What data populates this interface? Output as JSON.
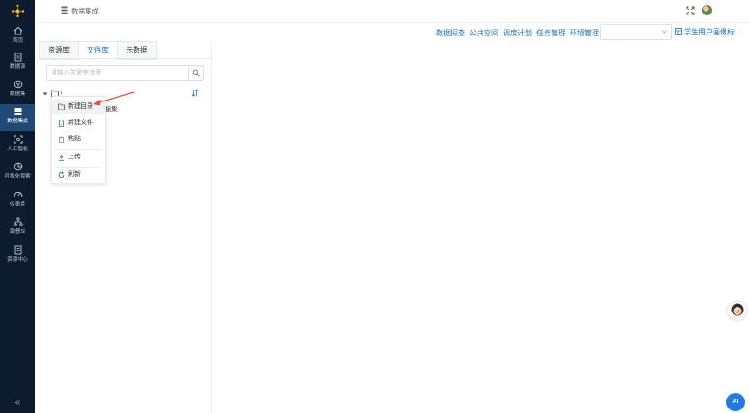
{
  "nav": {
    "items": [
      {
        "label": "首页",
        "icon": "home-icon"
      },
      {
        "label": "数据源",
        "icon": "database-icon"
      },
      {
        "label": "数据集",
        "icon": "dataset-icon"
      },
      {
        "label": "数据集成",
        "icon": "integration-icon",
        "active": true
      },
      {
        "label": "人工智能",
        "icon": "ai-icon"
      },
      {
        "label": "可视化探索",
        "icon": "chart-icon"
      },
      {
        "label": "仪表盘",
        "icon": "dashboard-icon"
      },
      {
        "label": "助督SI",
        "icon": "tree-icon"
      },
      {
        "label": "资源中心",
        "icon": "book-icon"
      }
    ],
    "collapse_glyph": "«",
    "active_color": "#1f4a78"
  },
  "header": {
    "breadcrumb": "数据集成",
    "links": [
      "数据探查",
      "公共空间",
      "调度计划",
      "任务管理",
      "环境管理"
    ],
    "select_value": "",
    "profile_link": "学生用户画像标..."
  },
  "panel": {
    "tabs": [
      "资源库",
      "文件库",
      "元数据"
    ],
    "active_tab": 1,
    "search_placeholder": "请输入关键字检索",
    "tree_root": "/",
    "tree_child_visible": "据集"
  },
  "context_menu": {
    "items": [
      {
        "label": "新建目录",
        "icon": "folder-icon"
      },
      {
        "label": "新建文件",
        "icon": "file-icon"
      },
      {
        "label": "粘贴",
        "icon": "paste-icon"
      },
      {
        "label": "上传",
        "icon": "upload-icon"
      },
      {
        "label": "刷新",
        "icon": "refresh-icon"
      }
    ],
    "highlighted": 0
  },
  "ai_button": "AI",
  "colors": {
    "accent": "#1a73c9",
    "nav_bg": "#0d1b2e",
    "annotation_arrow": "#e84a3c"
  }
}
